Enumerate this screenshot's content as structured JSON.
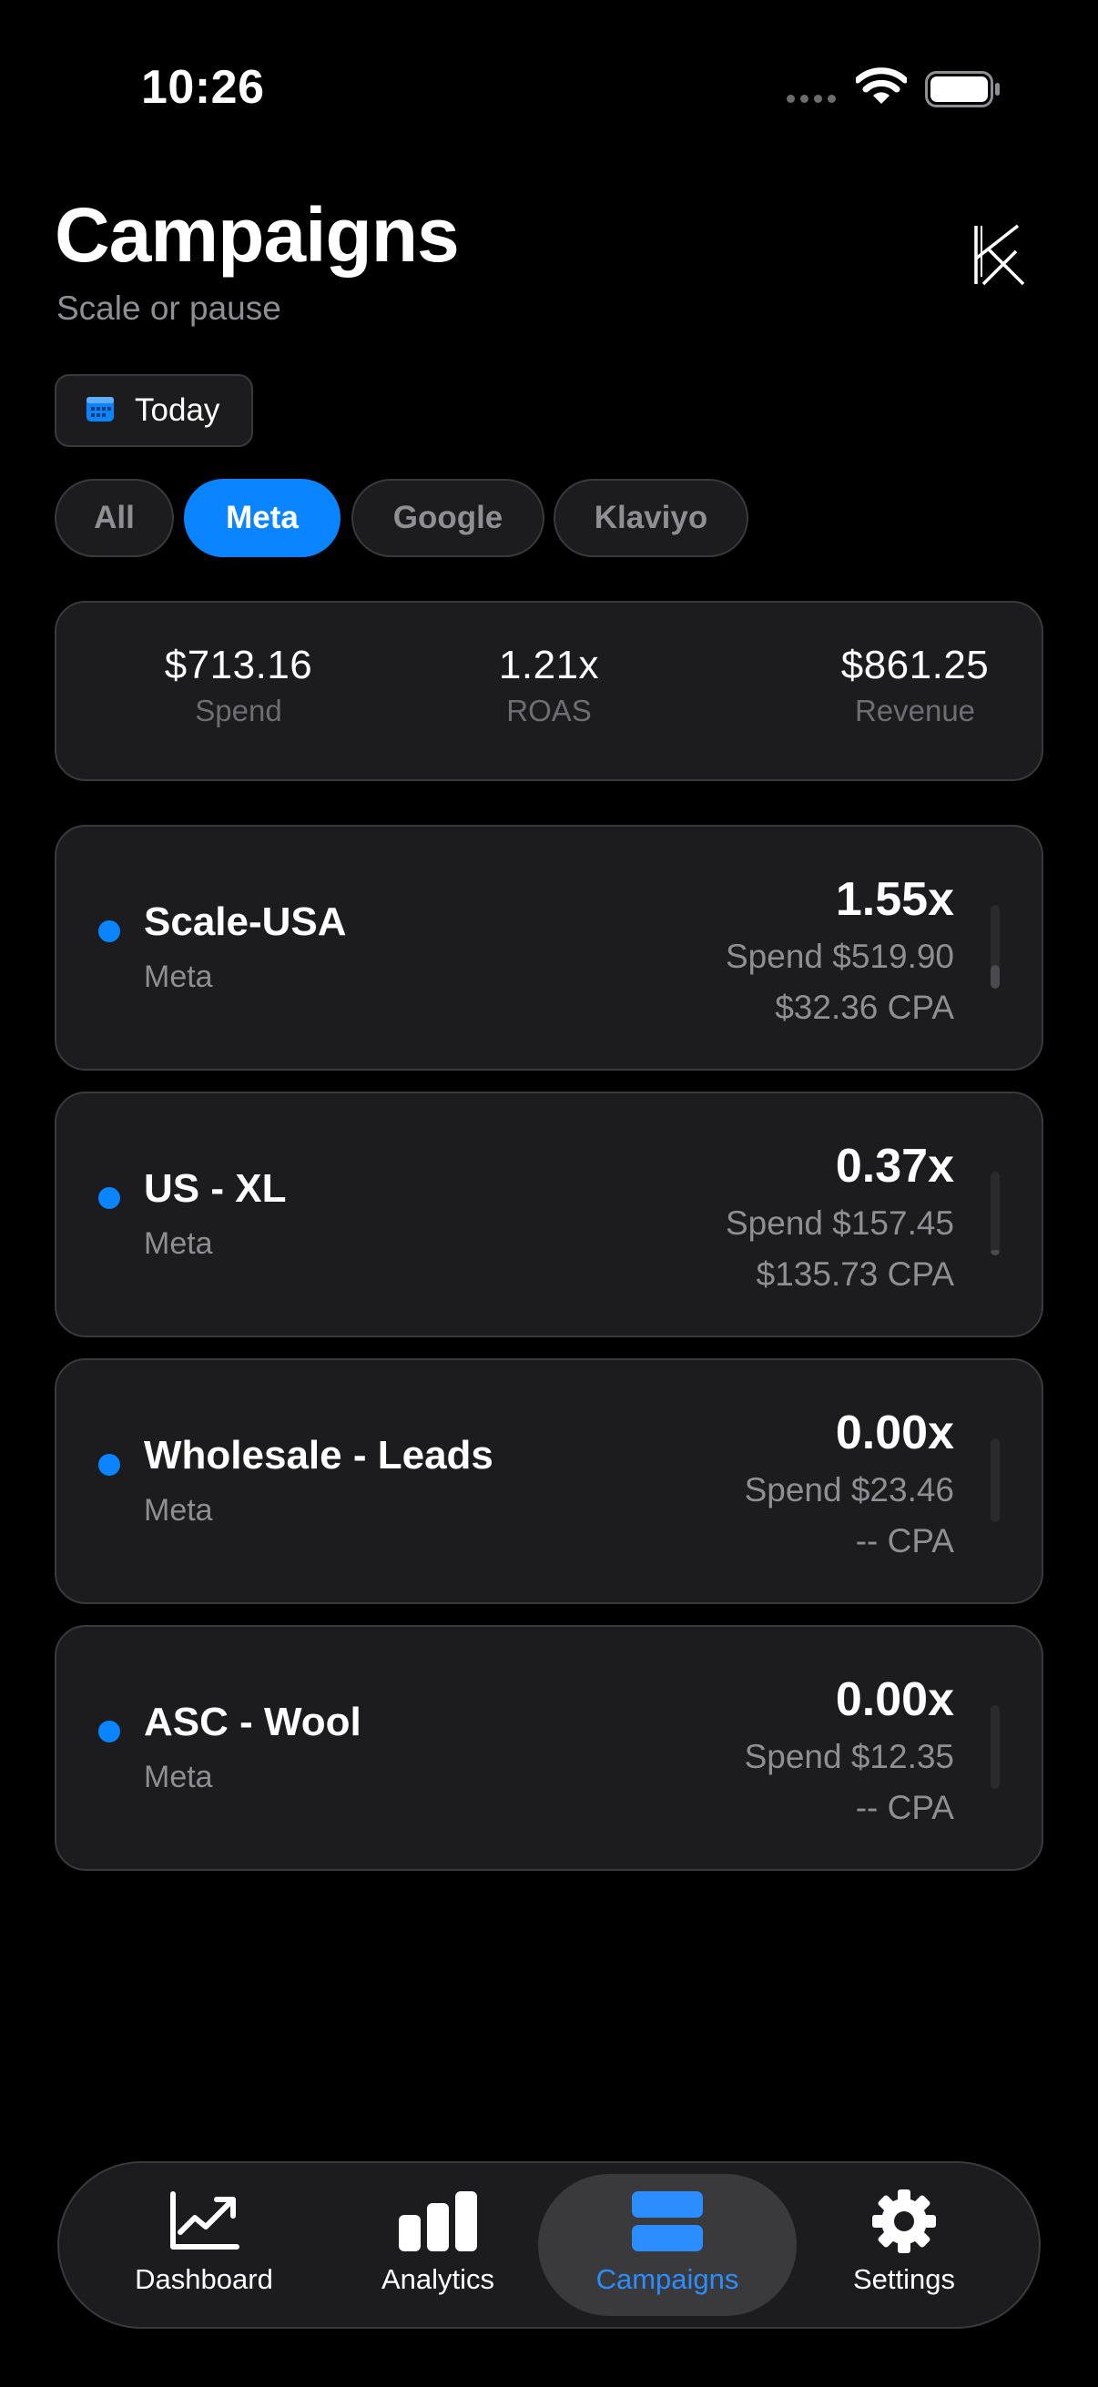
{
  "status_bar": {
    "time": "10:26"
  },
  "header": {
    "title": "Campaigns",
    "subtitle": "Scale or pause"
  },
  "date_filter": {
    "label": "Today"
  },
  "platform_filters": [
    {
      "label": "All",
      "active": false
    },
    {
      "label": "Meta",
      "active": true
    },
    {
      "label": "Google",
      "active": false
    },
    {
      "label": "Klaviyo",
      "active": false
    }
  ],
  "summary": {
    "spend": {
      "value": "$713.16",
      "label": "Spend"
    },
    "roas": {
      "value": "1.21x",
      "label": "ROAS"
    },
    "revenue": {
      "value": "$861.25",
      "label": "Revenue"
    }
  },
  "campaigns": [
    {
      "name": "Scale-USA",
      "platform": "Meta",
      "roas": "1.55x",
      "spend": "Spend $519.90",
      "cpa": "$32.36 CPA",
      "bar_level": 0.28
    },
    {
      "name": "US - XL",
      "platform": "Meta",
      "roas": "0.37x",
      "spend": "Spend $157.45",
      "cpa": "$135.73 CPA",
      "bar_level": 0.06
    },
    {
      "name": "Wholesale - Leads",
      "platform": "Meta",
      "roas": "0.00x",
      "spend": "Spend $23.46",
      "cpa": "-- CPA",
      "bar_level": 0.0
    },
    {
      "name": "ASC - Wool",
      "platform": "Meta",
      "roas": "0.00x",
      "spend": "Spend $12.35",
      "cpa": "-- CPA",
      "bar_level": 0.0
    }
  ],
  "tab_bar": {
    "tabs": [
      {
        "label": "Dashboard",
        "icon": "chart-line-icon",
        "active": false
      },
      {
        "label": "Analytics",
        "icon": "bar-chart-icon",
        "active": false
      },
      {
        "label": "Campaigns",
        "icon": "stack-icon",
        "active": true
      },
      {
        "label": "Settings",
        "icon": "gear-icon",
        "active": false
      }
    ]
  },
  "colors": {
    "background": "#000000",
    "card": "#1c1c1e",
    "card_border": "#3a3a3c",
    "accent": "#0a84ff",
    "secondary_text": "#8e8e93"
  }
}
